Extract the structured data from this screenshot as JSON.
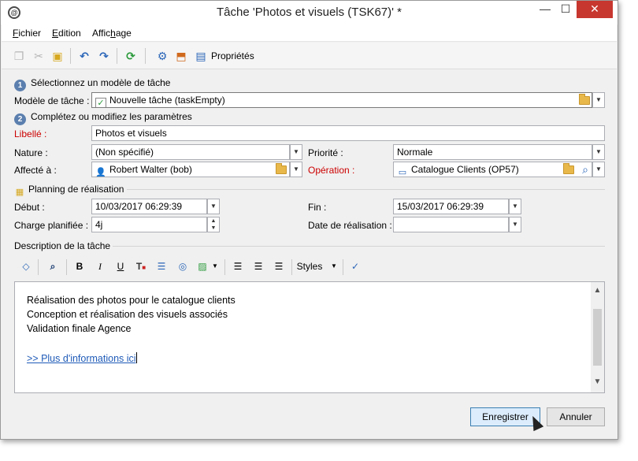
{
  "window": {
    "title": "Tâche 'Photos et visuels (TSK67)' *",
    "min": "—",
    "max": "☐",
    "close": "✕",
    "app_icon": "@"
  },
  "menu": [
    {
      "pre": "",
      "u": "F",
      "post": "ichier"
    },
    {
      "pre": "",
      "u": "E",
      "post": "dition"
    },
    {
      "pre": "Affic",
      "u": "h",
      "post": "age"
    }
  ],
  "toolbar": {
    "properties_label": "Propriétés"
  },
  "step1": {
    "num": "1",
    "label": "Sélectionnez un modèle de tâche"
  },
  "template": {
    "label": "Modèle de tâche :",
    "value": "Nouvelle tâche (taskEmpty)"
  },
  "step2": {
    "num": "2",
    "label": "Complétez ou modifiez les paramètres"
  },
  "libelle": {
    "label": "Libellé :",
    "value": "Photos et visuels"
  },
  "nature": {
    "label": "Nature :",
    "value": "(Non spécifié)"
  },
  "priorite": {
    "label": "Priorité :",
    "value": "Normale"
  },
  "affecte": {
    "label": "Affecté à :",
    "value": "Robert Walter (bob)"
  },
  "operation": {
    "label": "Opération :",
    "value": "Catalogue Clients (OP57)"
  },
  "planning": {
    "label": "Planning de réalisation"
  },
  "debut": {
    "label": "Début :",
    "value": "10/03/2017 06:29:39"
  },
  "fin": {
    "label": "Fin :",
    "value": "15/03/2017 06:29:39"
  },
  "charge": {
    "label": "Charge planifiée :",
    "value": "4j"
  },
  "date_real": {
    "label": "Date de réalisation :",
    "value": ""
  },
  "description": {
    "label": "Description de la tâche"
  },
  "editor_toolbar": {
    "styles": "Styles"
  },
  "editor": {
    "lines": [
      "Réalisation des photos pour le catalogue clients",
      "Conception et réalisation des visuels associés",
      "Validation finale Agence"
    ],
    "link": ">> Plus d'informations ici"
  },
  "buttons": {
    "save": "Enregistrer",
    "cancel": "Annuler"
  }
}
